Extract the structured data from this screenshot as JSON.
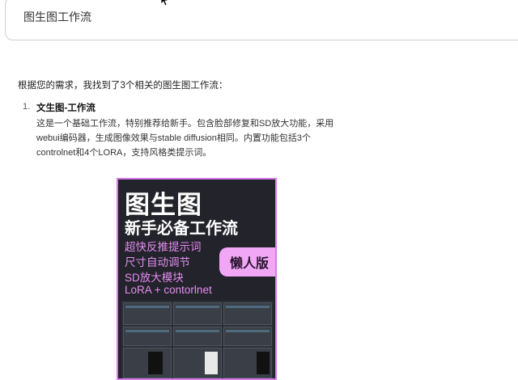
{
  "search": {
    "query": "图生图工作流"
  },
  "response": {
    "intro": "根据您的需求，我找到了3个相关的图生图工作流：",
    "items": [
      {
        "number": "1.",
        "title": "文生图-工作流",
        "description_lines": [
          "这是一个基础工作流，特别推荐给新手。包含脸部修复和SD放大功能，采用",
          "webui编码器，生成图像效果与stable diffusion相同。内置功能包括3个",
          "controlnet和4个LORA，支持风格类提示词。"
        ]
      }
    ]
  },
  "poster": {
    "title_line1": "图生图",
    "title_line2": "新手必备工作流",
    "features": [
      "超快反推提示词",
      "尺寸自动调节",
      "SD放大模块",
      "LoRA + contorlnet"
    ],
    "badge": "懒人版",
    "colors": {
      "background": "#23232b",
      "accent": "#e58cf2",
      "badge": "#f2a7f6",
      "border": "#d77ae8"
    }
  },
  "icons": {
    "cursor": "mouse-pointer-icon"
  }
}
